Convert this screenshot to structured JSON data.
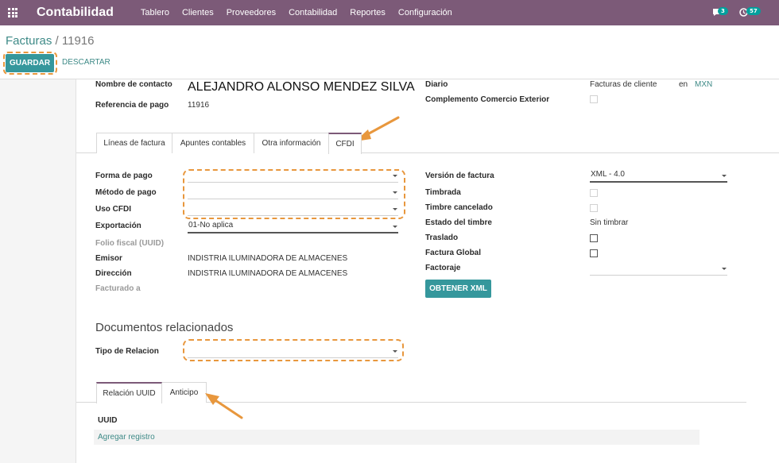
{
  "nav": {
    "brand": "Contabilidad",
    "menu": [
      "Tablero",
      "Clientes",
      "Proveedores",
      "Contabilidad",
      "Reportes",
      "Configuración"
    ],
    "messages_badge": "3",
    "activities_badge": "57"
  },
  "breadcrumb": {
    "parent": "Facturas",
    "separator": " / ",
    "current": "11916"
  },
  "actions": {
    "save": "GUARDAR",
    "discard": "DESCARTAR"
  },
  "header": {
    "contact_label": "Nombre de contacto",
    "contact_value": "ALEJANDRO ALONSO MENDEZ SILVA",
    "payment_ref_label": "Referencia de pago",
    "payment_ref_value": "11916",
    "journal_label": "Diario",
    "journal_value": "Facturas de cliente",
    "currency_prefix": "en",
    "currency_value": "MXN",
    "foreign_trade_label": "Complemento Comercio Exterior"
  },
  "tabs": [
    "Líneas de factura",
    "Apuntes contables",
    "Otra información",
    "CFDI"
  ],
  "cfdi": {
    "payment_form_label": "Forma de pago",
    "payment_method_label": "Método de pago",
    "cfdi_use_label": "Uso CFDI",
    "export_label": "Exportación",
    "export_value": "01-No aplica",
    "uuid_label": "Folio fiscal (UUID)",
    "issuer_label": "Emisor",
    "issuer_value": "INDISTRIA ILUMINADORA DE ALMACENES",
    "address_label": "Dirección",
    "address_value": "INDISTRIA ILUMINADORA DE ALMACENES",
    "billed_to_label": "Facturado a",
    "version_label": "Versión de factura",
    "version_value": "XML - 4.0",
    "stamped_label": "Timbrada",
    "stamp_cancelled_label": "Timbre cancelado",
    "stamp_status_label": "Estado del timbre",
    "stamp_status_value": "Sin timbrar",
    "transfer_label": "Traslado",
    "global_invoice_label": "Factura Global",
    "factoring_label": "Factoraje",
    "get_xml_button": "OBTENER XML"
  },
  "related": {
    "title": "Documentos relacionados",
    "relation_type_label": "Tipo de Relacion",
    "tabs": [
      "Relación UUID",
      "Anticipo"
    ],
    "column_uuid": "UUID",
    "add_record": "Agregar registro"
  },
  "colors": {
    "navbar": "#7c5a78",
    "primary_button": "#35979c",
    "link": "#3e8a87",
    "annotation": "#e8973d"
  }
}
